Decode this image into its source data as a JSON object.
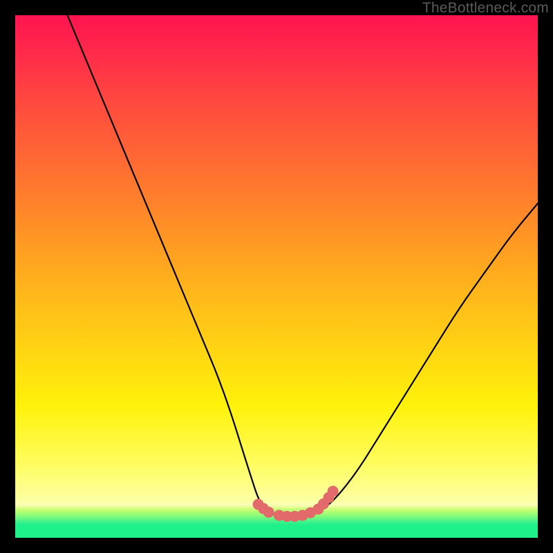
{
  "watermark": "TheBottleneck.com",
  "colors": {
    "frame": "#000000",
    "green_bar": "#1ef08a",
    "marker": "#e26a6a",
    "curve": "#000000"
  },
  "stripes": [
    "#f9ffb8",
    "#edff9e",
    "#d9ff86",
    "#c6ff78",
    "#b0ff72",
    "#9aff74",
    "#84fb7a",
    "#6ef780",
    "#58f486",
    "#42f28a",
    "#2df08c",
    "#1ef08a"
  ],
  "chart_data": {
    "type": "line",
    "title": "",
    "xlabel": "",
    "ylabel": "",
    "xlim": [
      0,
      100
    ],
    "ylim": [
      0,
      100
    ],
    "grid": false,
    "comment": "V-shaped bottleneck curve on red→yellow→green gradient. X and Y are percent of plot area (0–100, origin bottom-left). Values estimated from gridless chart ~±3.",
    "series": [
      {
        "name": "bottleneck-curve",
        "x": [
          10,
          15,
          20,
          25,
          30,
          35,
          40,
          45,
          47,
          50,
          53,
          56,
          60,
          65,
          70,
          75,
          80,
          85,
          90,
          95,
          100
        ],
        "y": [
          100,
          88,
          76,
          64,
          52,
          40,
          28,
          12,
          6,
          4,
          4,
          4,
          6,
          12,
          20,
          28,
          36,
          44,
          51,
          58,
          64
        ]
      }
    ],
    "markers": {
      "name": "highlight-dots",
      "x": [
        46.5,
        47.5,
        48.5,
        50.5,
        52.0,
        53.5,
        55.0,
        56.5,
        58.0,
        59.0,
        60.0,
        60.8
      ],
      "y": [
        6.4,
        5.6,
        4.9,
        4.3,
        4.1,
        4.1,
        4.3,
        4.8,
        5.5,
        6.5,
        7.7,
        8.9
      ]
    }
  }
}
